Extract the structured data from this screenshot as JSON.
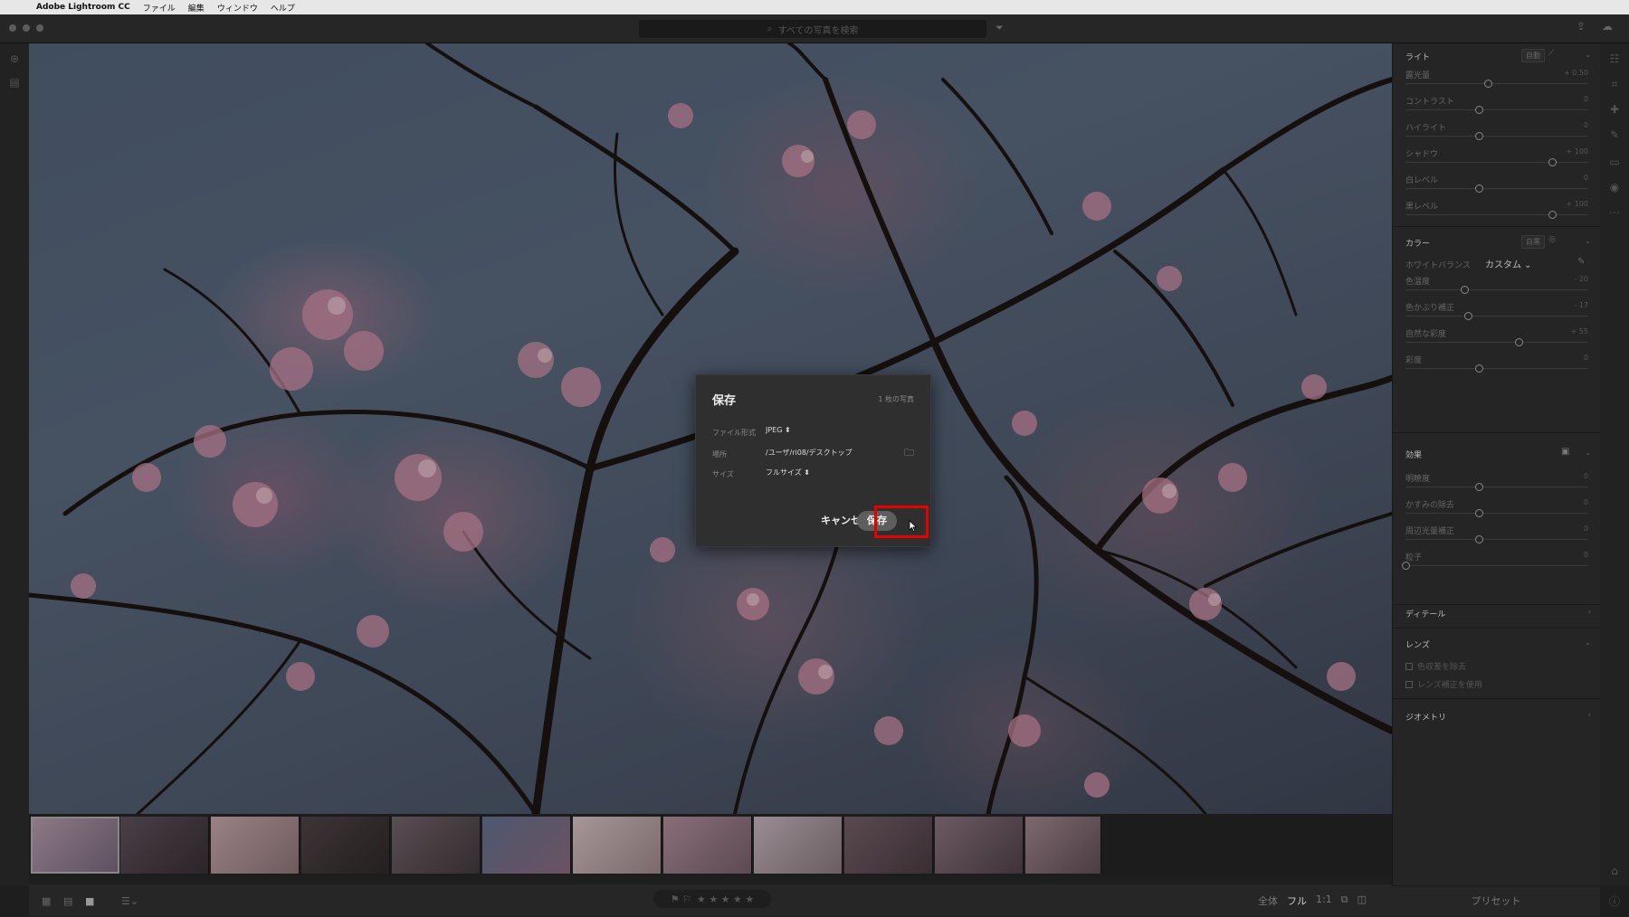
{
  "menubar": {
    "app": "Adobe Lightroom CC",
    "items": [
      "ファイル",
      "編集",
      "ウィンドウ",
      "ヘルプ"
    ]
  },
  "search": {
    "placeholder": "すべての写真を検索"
  },
  "dialog": {
    "title": "保存",
    "count": "1 枚の写真",
    "format_label": "ファイル形式",
    "format_value": "JPEG ⬍",
    "location_label": "場所",
    "location_value": "/ユーザ/ri08/デスクトップ",
    "size_label": "サイズ",
    "size_value": "フルサイズ ⬍",
    "cancel": "キャンセル",
    "save": "保存"
  },
  "panel": {
    "light": {
      "title": "ライト",
      "auto": "自動",
      "sliders": [
        {
          "label": "露光量",
          "value": "+ 0.50",
          "pos": 0.45
        },
        {
          "label": "コントラスト",
          "value": "0",
          "pos": 0.4
        },
        {
          "label": "ハイライト",
          "value": "0",
          "pos": 0.4
        },
        {
          "label": "シャドウ",
          "value": "+ 100",
          "pos": 0.8
        },
        {
          "label": "白レベル",
          "value": "0",
          "pos": 0.4
        },
        {
          "label": "黒レベル",
          "value": "+ 100",
          "pos": 0.8
        }
      ]
    },
    "color": {
      "title": "カラー",
      "auto": "白黒",
      "wb_label": "ホワイトバランス",
      "wb_value": "カスタム ⌄",
      "sliders": [
        {
          "label": "色温度",
          "value": "- 20",
          "pos": 0.32
        },
        {
          "label": "色かぶり補正",
          "value": "- 17",
          "pos": 0.34
        },
        {
          "label": "自然な彩度",
          "value": "+ 55",
          "pos": 0.62
        },
        {
          "label": "彩度",
          "value": "0",
          "pos": 0.4
        }
      ]
    },
    "effects": {
      "title": "効果",
      "sliders": [
        {
          "label": "明瞭度",
          "value": "0",
          "pos": 0.4
        },
        {
          "label": "かすみの除去",
          "value": "0",
          "pos": 0.4
        },
        {
          "label": "周辺光量補正",
          "value": "0",
          "pos": 0.4
        },
        {
          "label": "粒子",
          "value": "0",
          "pos": 0.0
        }
      ]
    },
    "detail": {
      "title": "ディテール"
    },
    "lens": {
      "title": "レンズ",
      "checks": [
        "色収差を除去",
        "レンズ補正を使用"
      ]
    },
    "geometry": {
      "title": "ジオメトリ"
    }
  },
  "bottom": {
    "zoom_all": "全体",
    "zoom_full": "フル",
    "zoom_1": "1:1",
    "stars": "★ ★ ★ ★ ★",
    "flags": "⚑ ⚐",
    "preset": "プリセット"
  }
}
